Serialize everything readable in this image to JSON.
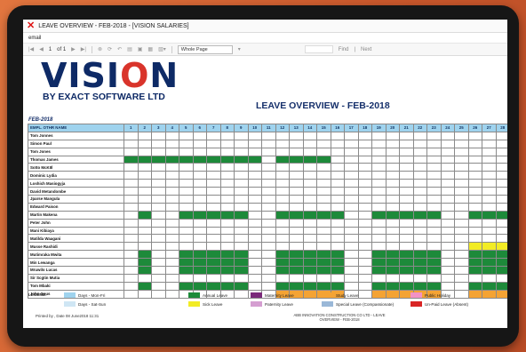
{
  "window": {
    "title": "LEAVE OVERVIEW - FEB-2018 - [VISION SALARIES]"
  },
  "menu": {
    "email": "email"
  },
  "toolbar": {
    "page_current": "1",
    "page_total": "of 1",
    "zoom": "Whole Page",
    "find": "Find",
    "next": "Next"
  },
  "logo": {
    "brand_v": "VISI",
    "brand_o": "O",
    "brand_n": "N",
    "tagline": "BY EXACT SOFTWARE LTD"
  },
  "report": {
    "title": "LEAVE OVERVIEW - FEB-2018",
    "month": "FEB-2018",
    "name_header": "EMPL. OTHR NAME"
  },
  "days": [
    "1",
    "2",
    "3",
    "4",
    "5",
    "6",
    "7",
    "8",
    "9",
    "10",
    "11",
    "12",
    "13",
    "14",
    "15",
    "16",
    "17",
    "18",
    "19",
    "20",
    "21",
    "22",
    "23",
    "24",
    "25",
    "26",
    "27",
    "28"
  ],
  "employees": [
    {
      "name": "Tom Jonnes",
      "code": "____________________________"
    },
    {
      "name": "Simon Paul",
      "code": "____________________________"
    },
    {
      "name": "Tom Jones",
      "code": "____________________________"
    },
    {
      "name": "Thomas James",
      "code": "AAAAAAAAAA_AAAA_____________"
    },
    {
      "name": "Sotto McKIIl",
      "code": "____________________________"
    },
    {
      "name": "Dominic Lydia",
      "code": "____________________________"
    },
    {
      "name": "Loshich Masiogyja",
      "code": "____________________________"
    },
    {
      "name": "David Metandombe",
      "code": "____________________________"
    },
    {
      "name": "Jparse Mangula",
      "code": "____________________________"
    },
    {
      "name": "Edward Paison",
      "code": "____________________________"
    },
    {
      "name": "Martin Makena",
      "code": "_A__AAAAA__AAAAA__AAAAA__AAA"
    },
    {
      "name": "Peter John",
      "code": "____________________________"
    },
    {
      "name": "Mani Kibiaya",
      "code": "____________________________"
    },
    {
      "name": "Matilda Waagani",
      "code": "____________________________"
    },
    {
      "name": "Musse Rashidi",
      "code": "_________________________PPP"
    },
    {
      "name": "Mutimraka Mwita",
      "code": "_A__AAAAA__AAAAA__AAAAA__AAA"
    },
    {
      "name": "Min Lewanga",
      "code": "_A__AAAAA__AAAAA__AAAAA__AAA"
    },
    {
      "name": "Mruwilo Lucas",
      "code": "_A__AAAAA__AAAAA__AAAAA__AAA"
    },
    {
      "name": "Sir Scgtin Mutia",
      "code": "____________________________"
    },
    {
      "name": "Tom Mbaki",
      "code": "_A__AAAAA__AAAAA__AAAAA__AAA"
    },
    {
      "name": "John Sous",
      "code": "___________SSSSS__SSSSS__SSS"
    }
  ],
  "legend": {
    "label": "LEGEND:",
    "items": [
      {
        "text": "Days - Mon-Fri",
        "color": "#9fd3ee"
      },
      {
        "text": "Days - Sat-Sun",
        "color": "#cfe6f4"
      },
      {
        "text": "Annual Leave",
        "color": "#1d8a3a"
      },
      {
        "text": "Sick Leave",
        "color": "#f2ec25"
      },
      {
        "text": "Maternity Leave",
        "color": "#7a2a7a"
      },
      {
        "text": "Paternity Leave",
        "color": "#d59ed1"
      },
      {
        "text": "Study Leave",
        "color": "#f4a334"
      },
      {
        "text": "Special Leave (Compassionate)",
        "color": "#9ab8d8"
      },
      {
        "text": "Public Holiday",
        "color": "#f392c4"
      },
      {
        "text": "Un-Paid Leave (Absent)",
        "color": "#d92525"
      }
    ]
  },
  "footer": {
    "printed": "Printed by , Date 08 June2018 11:31",
    "company": "ABB INNOVATION CONSTRUCTION CO LTD - LEAVE OVERVIEW - FEB-2018"
  }
}
